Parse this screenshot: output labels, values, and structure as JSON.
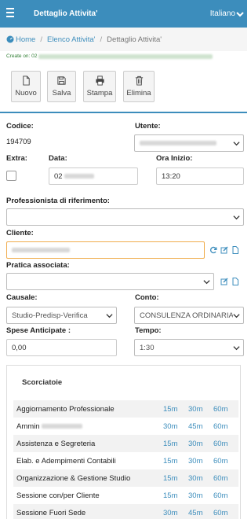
{
  "header": {
    "title": "Dettaglio Attivita'",
    "language": "Italiano"
  },
  "breadcrumb": {
    "home": "Home",
    "list": "Elenco Attivita'",
    "current": "Dettaglio Attivita'"
  },
  "created_label": "Create on: 02",
  "toolbar": {
    "new": "Nuovo",
    "save": "Salva",
    "print": "Stampa",
    "delete": "Elimina"
  },
  "form": {
    "codice_label": "Codice:",
    "codice_value": "194709",
    "utente_label": "Utente:",
    "extra_label": "Extra:",
    "data_label": "Data:",
    "data_value": "02",
    "ora_label": "Ora Inizio:",
    "ora_value": "13:20",
    "professionista_label": "Professionista di riferimento:",
    "cliente_label": "Cliente:",
    "pratica_label": "Pratica associata:",
    "causale_label": "Causale:",
    "causale_value": "Studio-Predisp-Verifica",
    "conto_label": "Conto:",
    "conto_value": "CONSULENZA ORDINARIA",
    "spese_label": "Spese Anticipate :",
    "spese_value": "0,00",
    "tempo_label": "Tempo:",
    "tempo_value": "1:30"
  },
  "shortcuts": {
    "title": "Scorciatoie",
    "rows": [
      {
        "name": "Aggiornamento Professionale",
        "t": [
          "15m",
          "30m",
          "60m"
        ]
      },
      {
        "name": "Ammin",
        "t": [
          "30m",
          "45m",
          "60m"
        ]
      },
      {
        "name": "Assistenza e Segreteria",
        "t": [
          "15m",
          "30m",
          "60m"
        ]
      },
      {
        "name": "Elab. e Adempimenti Contabili",
        "t": [
          "15m",
          "30m",
          "60m"
        ]
      },
      {
        "name": "Organizzazione & Gestione Studio",
        "t": [
          "15m",
          "30m",
          "60m"
        ]
      },
      {
        "name": "Sessione con/per Cliente",
        "t": [
          "15m",
          "30m",
          "60m"
        ]
      },
      {
        "name": "Sessione Fuori Sede",
        "t": [
          "30m",
          "45m",
          "60m"
        ]
      }
    ]
  },
  "colors": {
    "primary": "#3c8dbc",
    "active_border": "#f0ad4e"
  }
}
